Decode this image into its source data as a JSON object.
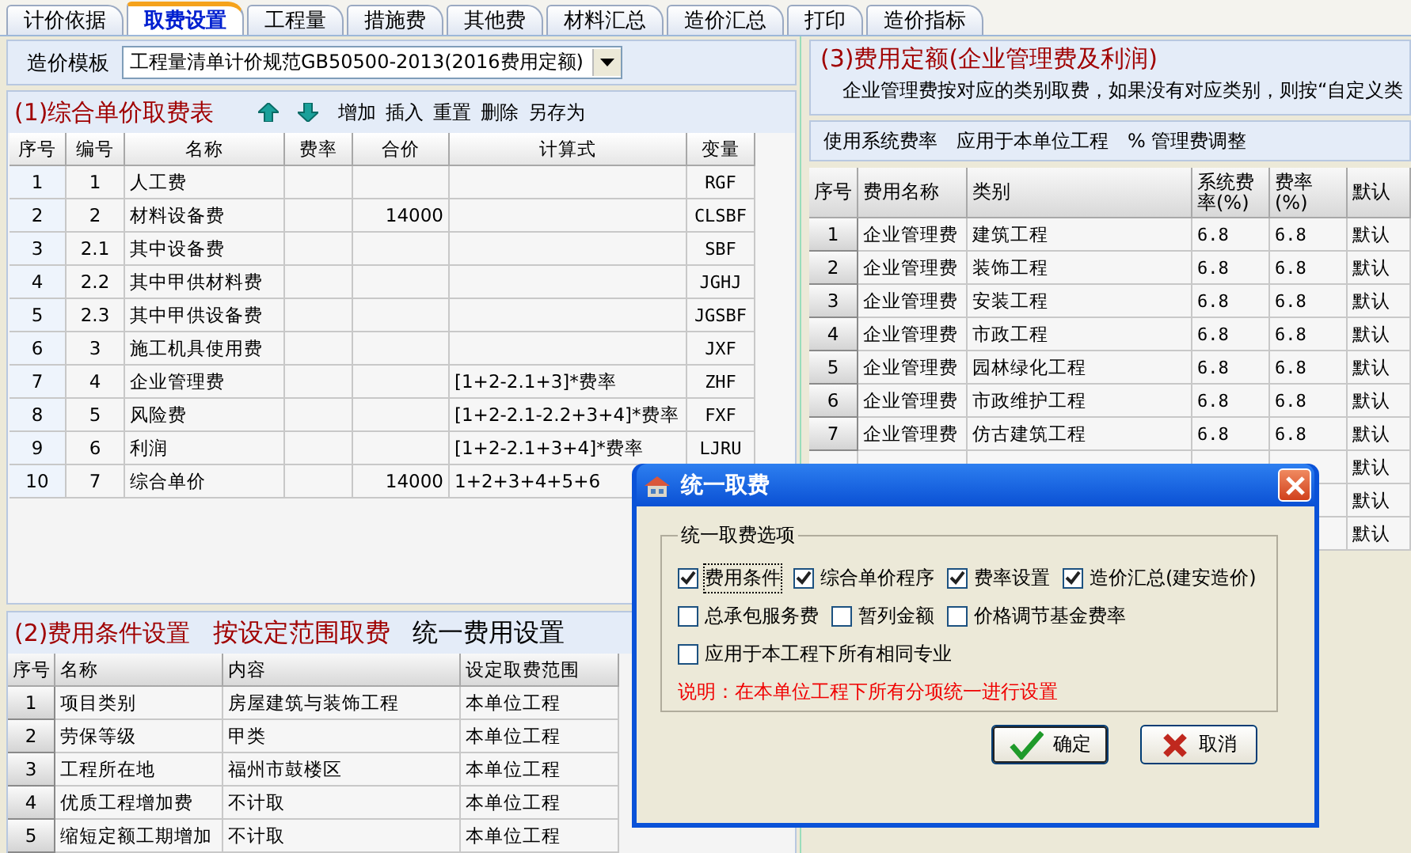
{
  "tabs": [
    {
      "label": "计价依据",
      "selected": false
    },
    {
      "label": "取费设置",
      "selected": true
    },
    {
      "label": "工程量",
      "selected": false
    },
    {
      "label": "措施费",
      "selected": false
    },
    {
      "label": "其他费",
      "selected": false
    },
    {
      "label": "材料汇总",
      "selected": false
    },
    {
      "label": "造价汇总",
      "selected": false
    },
    {
      "label": "打印",
      "selected": false
    },
    {
      "label": "造价指标",
      "selected": false
    }
  ],
  "template": {
    "label": "造价模板",
    "value": "工程量清单计价规范GB50500-2013(2016费用定额)"
  },
  "unit_price_table": {
    "title": "(1)综合单价取费表",
    "actions": [
      "增加",
      "插入",
      "重置",
      "删除",
      "另存为"
    ],
    "columns": [
      "序号",
      "编号",
      "名称",
      "费率",
      "合价",
      "计算式",
      "变量"
    ],
    "rows": [
      [
        "1",
        "1",
        "人工费",
        "",
        "",
        "",
        "RGF"
      ],
      [
        "2",
        "2",
        "材料设备费",
        "",
        "14000",
        "",
        "CLSBF"
      ],
      [
        "3",
        "2.1",
        "其中设备费",
        "",
        "",
        "",
        "SBF"
      ],
      [
        "4",
        "2.2",
        "其中甲供材料费",
        "",
        "",
        "",
        "JGHJ"
      ],
      [
        "5",
        "2.3",
        "其中甲供设备费",
        "",
        "",
        "",
        "JGSBF"
      ],
      [
        "6",
        "3",
        "施工机具使用费",
        "",
        "",
        "",
        "JXF"
      ],
      [
        "7",
        "4",
        "企业管理费",
        "",
        "",
        "[1+2-2.1+3]*费率",
        "ZHF"
      ],
      [
        "8",
        "5",
        "风险费",
        "",
        "",
        "[1+2-2.1-2.2+3+4]*费率",
        "FXF"
      ],
      [
        "9",
        "6",
        "利润",
        "",
        "",
        "[1+2-2.1+3+4]*费率",
        "LJRU"
      ],
      [
        "10",
        "7",
        "综合单价",
        "",
        "14000",
        "1+2+3+4+5+6",
        ""
      ]
    ]
  },
  "condition_table": {
    "title": "(2)费用条件设置",
    "range_button": "按设定范围取费",
    "unify_button": "统一费用设置",
    "columns": [
      "序号",
      "名称",
      "内容",
      "设定取费范围"
    ],
    "rows": [
      [
        "1",
        "项目类别",
        "房屋建筑与装饰工程",
        "本单位工程"
      ],
      [
        "2",
        "劳保等级",
        "甲类",
        "本单位工程"
      ],
      [
        "3",
        "工程所在地",
        "福州市鼓楼区",
        "本单位工程"
      ],
      [
        "4",
        "优质工程增加费",
        "不计取",
        "本单位工程"
      ],
      [
        "5",
        "缩短定额工期增加",
        "不计取",
        "本单位工程"
      ]
    ]
  },
  "quota_panel": {
    "title": "(3)费用定额(企业管理费及利润)",
    "note": "企业管理费按对应的类别取费，如果没有对应类别，则按“自定义类",
    "actions": [
      "使用系统费率",
      "应用于本单位工程",
      "% 管理费调整"
    ],
    "columns": [
      "序号",
      "费用名称",
      "类别",
      "系统费率(%)",
      "费率(%)",
      "默认"
    ],
    "rows": [
      [
        "1",
        "企业管理费",
        "建筑工程",
        "6.8",
        "6.8",
        "默认"
      ],
      [
        "2",
        "企业管理费",
        "装饰工程",
        "6.8",
        "6.8",
        "默认"
      ],
      [
        "3",
        "企业管理费",
        "安装工程",
        "6.8",
        "6.8",
        "默认"
      ],
      [
        "4",
        "企业管理费",
        "市政工程",
        "6.8",
        "6.8",
        "默认"
      ],
      [
        "5",
        "企业管理费",
        "园林绿化工程",
        "6.8",
        "6.8",
        "默认"
      ],
      [
        "6",
        "企业管理费",
        "市政维护工程",
        "6.8",
        "6.8",
        "默认"
      ],
      [
        "7",
        "企业管理费",
        "仿古建筑工程",
        "6.8",
        "6.8",
        "默认"
      ],
      [
        "",
        "",
        "",
        "",
        "",
        "默认"
      ],
      [
        "",
        "",
        "",
        "",
        "",
        "默认"
      ],
      [
        "",
        "",
        "",
        "",
        "",
        "默认"
      ]
    ]
  },
  "dialog": {
    "title": "统一取费",
    "group": "统一取费选项",
    "option_lines": [
      [
        {
          "label": "费用条件",
          "checked": true
        },
        {
          "label": "综合单价程序",
          "checked": true
        },
        {
          "label": "费率设置",
          "checked": true
        },
        {
          "label": "造价汇总(建安造价)",
          "checked": true
        }
      ],
      [
        {
          "label": "总承包服务费",
          "checked": false
        },
        {
          "label": "暂列金额",
          "checked": false
        },
        {
          "label": "价格调节基金费率",
          "checked": false
        }
      ],
      [
        {
          "label": "应用于本工程下所有相同专业",
          "checked": false
        }
      ]
    ],
    "note": "说明：在本单位工程下所有分项统一进行设置",
    "buttons": [
      {
        "label": "确定",
        "kind": "ok"
      },
      {
        "label": "取消",
        "kind": "cancel"
      }
    ]
  }
}
